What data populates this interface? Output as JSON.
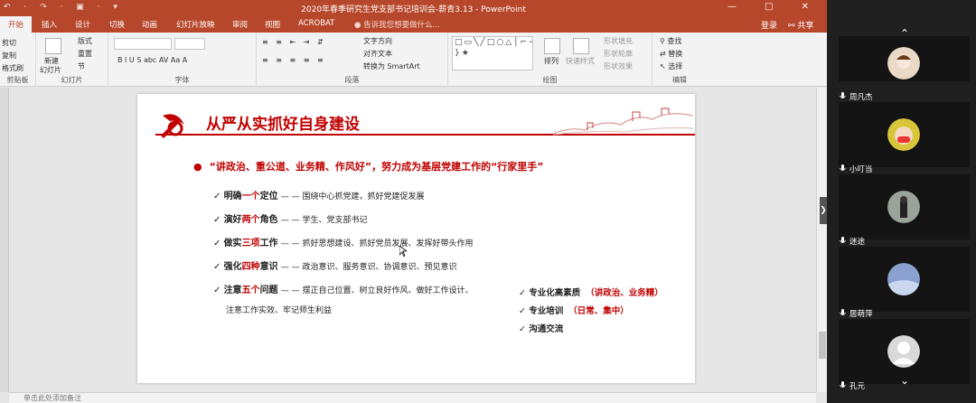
{
  "app": {
    "window_title": "2020年春季研究生党支部书记培训会-薪青3.13 - PowerPoint",
    "qat": "↶ · ↷ · ▣ · ▾",
    "window_controls": "— □ ✕"
  },
  "tabs": [
    "开始",
    "插入",
    "设计",
    "切换",
    "动画",
    "幻灯片放映",
    "审阅",
    "视图",
    "ACROBAT"
  ],
  "tell_me": "告诉我您想要做什么...",
  "login": "登录",
  "share": "共享",
  "ribbon": {
    "clipboard": {
      "label": "剪贴板",
      "cut": "剪切",
      "copy": "复制",
      "format_painter": "格式刷"
    },
    "slides": {
      "label": "幻灯片",
      "new_slide": "新建",
      "new_slide2": "幻灯片",
      "layout": "版式",
      "reset": "重置",
      "section": "节"
    },
    "font": {
      "label": "字体",
      "buttons": "B  I  U  S  abc  AV  Aa  A"
    },
    "paragraph": {
      "label": "段落",
      "text_direction": "文字方向",
      "align_text": "对齐文本",
      "smartart": "转换为 SmartArt"
    },
    "drawing": {
      "label": "绘图",
      "arrange": "排列",
      "quick_styles": "快速样式",
      "fill": "形状填充",
      "outline": "形状轮廓",
      "effects": "形状效果",
      "shapes_glyphs": "□▭╲╱□○△│⌐→⇨◇⬠⌒╰╮⤴{ }★"
    },
    "editing": {
      "label": "编辑",
      "find": "查找",
      "replace": "替换",
      "select": "选择"
    }
  },
  "slide": {
    "title": "从严从实抓好自身建设",
    "headline": "“讲政治、重公道、业务精、作风好”，努力成为基层党建工作的“行家里手”",
    "items": [
      {
        "pre": "明确",
        "hl": "一个",
        "post": "定位",
        "desc": "— — 围绕中心抓党建，抓好党建促发展"
      },
      {
        "pre": "演好",
        "hl": "两个",
        "post": "角色",
        "desc": "— — 学生、党支部书记"
      },
      {
        "pre": "做实",
        "hl": "三项",
        "post": "工作",
        "desc": "— — 抓好思想建设、抓好党员发展、发挥好带头作用"
      },
      {
        "pre": "强化",
        "hl": "四种",
        "post": "意识",
        "desc": "— — 政治意识、服务意识、协调意识、预见意识"
      },
      {
        "pre": "注意",
        "hl": "五个",
        "post": "问题",
        "desc": "— — 摆正自己位置、树立良好作风、做好工作设计、"
      }
    ],
    "item_continuation": "注意工作实效、牢记师生利益",
    "right_items": [
      {
        "label": "专业化高素质",
        "note": "（讲政治、业务精）"
      },
      {
        "label": "专业培训",
        "note": "（日常、集中）"
      },
      {
        "label": "沟通交流",
        "note": ""
      }
    ]
  },
  "notes_placeholder": "单击此处添加备注",
  "participants": [
    {
      "name": "周凡杰",
      "avatar_color": "#e9d9c6"
    },
    {
      "name": "小叮当",
      "avatar_color": "#d8c53a"
    },
    {
      "name": "迷途",
      "avatar_color": "#9aa39a"
    },
    {
      "name": "居萌萍",
      "avatar_color": "#8aa1cf"
    },
    {
      "name": "孔元",
      "avatar_color": "#d9d9d9"
    }
  ],
  "colors": {
    "accent": "#b7472a",
    "slide_red": "#c00000"
  }
}
